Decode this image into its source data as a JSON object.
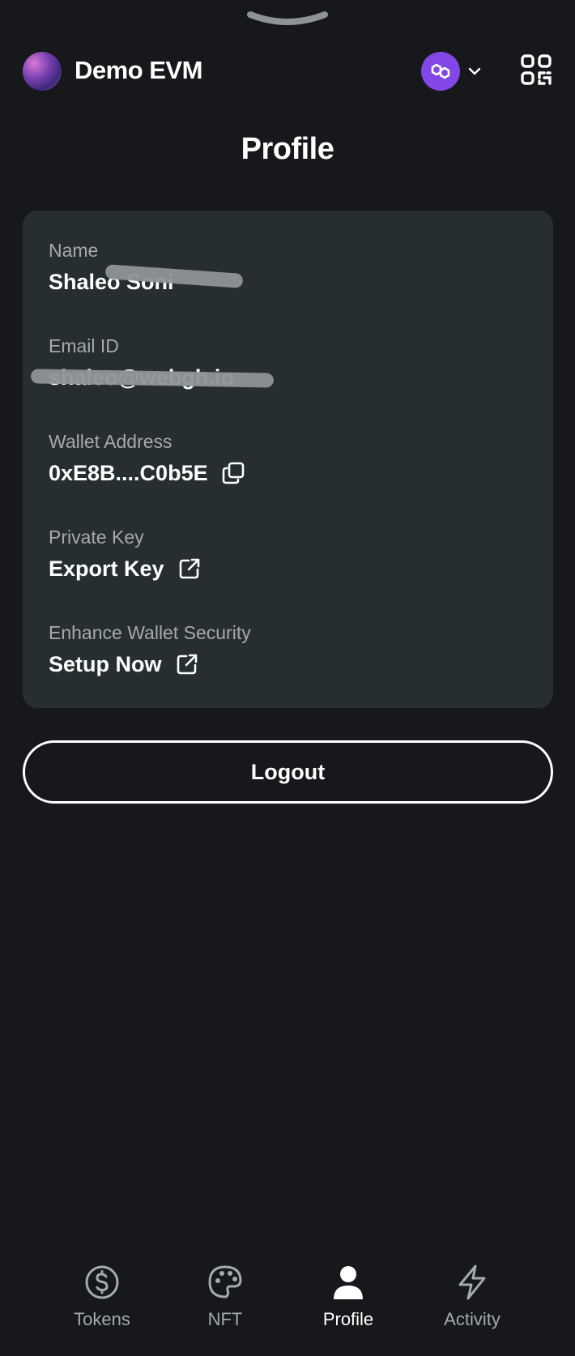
{
  "header": {
    "app_title": "Demo EVM",
    "chain_icon": "polygon-icon",
    "accent": "#8247e5"
  },
  "page": {
    "title": "Profile"
  },
  "profile": {
    "name_label": "Name",
    "name_value": "Shaleo Soni",
    "email_label": "Email ID",
    "email_value": "shaleo@webgh.io",
    "wallet_label": "Wallet Address",
    "wallet_value": "0xE8B....C0b5E",
    "private_key_label": "Private Key",
    "private_key_action": "Export Key",
    "security_label": "Enhance Wallet Security",
    "security_action": "Setup Now"
  },
  "logout_label": "Logout",
  "tabs": [
    {
      "label": "Tokens",
      "icon": "dollar-circle-icon",
      "active": false
    },
    {
      "label": "NFT",
      "icon": "palette-icon",
      "active": false
    },
    {
      "label": "Profile",
      "icon": "user-icon",
      "active": true
    },
    {
      "label": "Activity",
      "icon": "lightning-icon",
      "active": false
    }
  ]
}
